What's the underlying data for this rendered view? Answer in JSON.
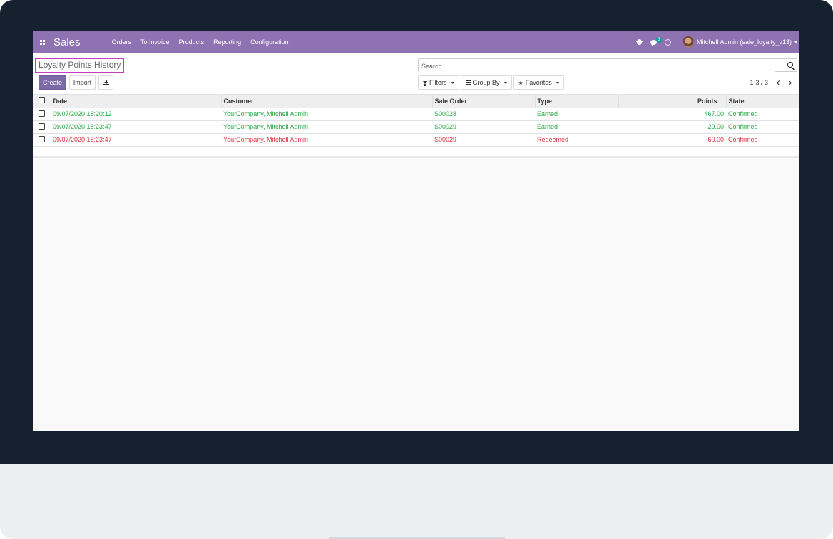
{
  "navbar": {
    "brand": "Sales",
    "menu": [
      "Orders",
      "To Invoice",
      "Products",
      "Reporting",
      "Configuration"
    ],
    "messages_badge": "3",
    "user": "Mitchell Admin (sale_loyalty_v13)"
  },
  "control": {
    "breadcrumb": "Loyalty Points History",
    "create_label": "Create",
    "import_label": "Import",
    "search_placeholder": "Search...",
    "filters_label": "Filters",
    "groupby_label": "Group By",
    "favorites_label": "Favorites",
    "pager": "1-3 / 3"
  },
  "table": {
    "columns": [
      "Date",
      "Customer",
      "Sale Order",
      "Type",
      "Points",
      "State"
    ],
    "rows": [
      {
        "date": "09/07/2020 18:20:12",
        "customer": "YourCompany, Mitchell Admin",
        "order": "S00028",
        "type": "Earned",
        "points": "467.00",
        "state": "Confirmed",
        "status": "earned"
      },
      {
        "date": "09/07/2020 18:23:47",
        "customer": "YourCompany, Mitchell Admin",
        "order": "S00029",
        "type": "Earned",
        "points": "29.00",
        "state": "Confirmed",
        "status": "earned"
      },
      {
        "date": "09/07/2020 18:23:47",
        "customer": "YourCompany, Mitchell Admin",
        "order": "S00029",
        "type": "Redeemed",
        "points": "-60.00",
        "state": "Confirmed",
        "status": "redeemed"
      }
    ]
  },
  "colors": {
    "navbar": "#8e72b1",
    "earned": "#28a745",
    "redeemed": "#dc3545"
  }
}
